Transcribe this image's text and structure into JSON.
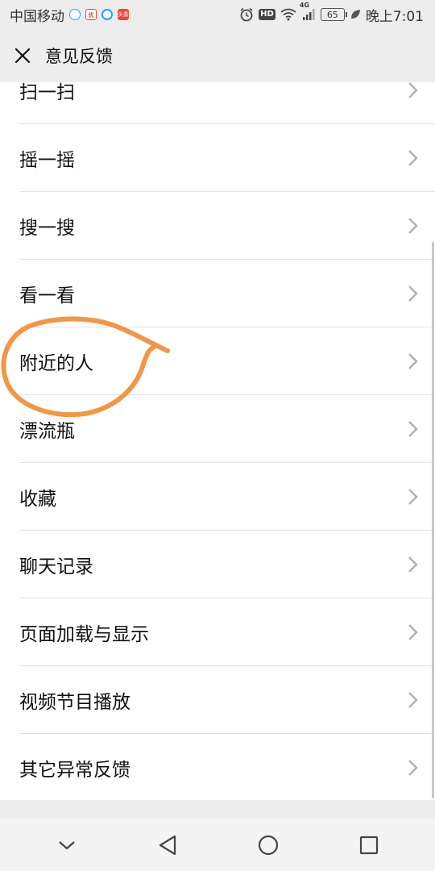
{
  "status_bar": {
    "carrier": "中国移动",
    "network": "4G",
    "hd": "HD",
    "battery": "65",
    "time": "晚上7:01",
    "app_icon_1_text": "优酷",
    "app_icon_2_text": "头条"
  },
  "header": {
    "title": "意见反馈"
  },
  "list": {
    "items": [
      {
        "label": "扫一扫"
      },
      {
        "label": "摇一摇"
      },
      {
        "label": "搜一搜"
      },
      {
        "label": "看一看"
      },
      {
        "label": "附近的人"
      },
      {
        "label": "漂流瓶"
      },
      {
        "label": "收藏"
      },
      {
        "label": "聊天记录"
      },
      {
        "label": "页面加载与显示"
      },
      {
        "label": "视频节目播放"
      },
      {
        "label": "其它异常反馈"
      }
    ]
  },
  "colors": {
    "highlight": "#f0974a",
    "chevron": "#b2b2b2",
    "background": "#ededed"
  }
}
